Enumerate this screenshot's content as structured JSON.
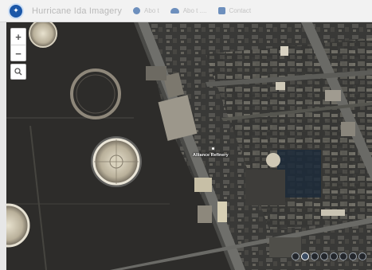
{
  "header": {
    "app_title": "Hurricane Ida Imagery",
    "nav": [
      {
        "label": "Abo t",
        "icon": "info-icon"
      },
      {
        "label": "Abo t  ....",
        "icon": "cloud-icon"
      },
      {
        "label": "Contact",
        "icon": "mail-icon"
      }
    ],
    "logo": "noaa-logo"
  },
  "map": {
    "zoom_in_label": "+",
    "zoom_out_label": "−",
    "place_label": "Alliance Refinery",
    "thumbnail_count": 8,
    "active_thumbnail": 1
  },
  "colors": {
    "header_bg": "#f2f2f2",
    "water": "#2b2a28",
    "logo": "#1b57a8"
  }
}
